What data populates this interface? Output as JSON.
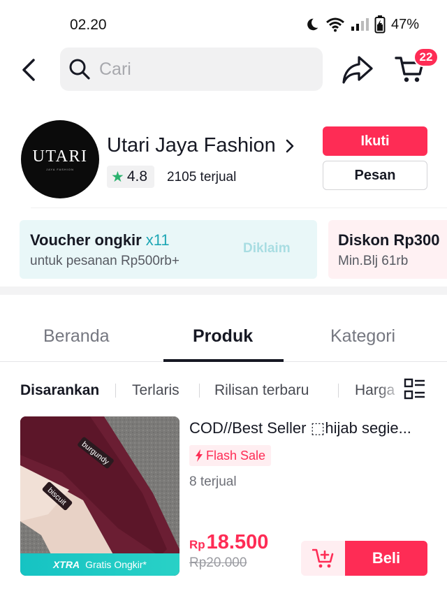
{
  "status_bar": {
    "time": "02.20",
    "battery": "47%",
    "icons": [
      "moon-icon",
      "wifi-icon",
      "signal-icon",
      "battery-charging-icon"
    ]
  },
  "top_nav": {
    "search_placeholder": "Cari",
    "cart_badge": "22",
    "icons": [
      "back-arrow-icon",
      "search-icon",
      "share-icon",
      "cart-icon"
    ]
  },
  "shop": {
    "logo_text": "UTARI",
    "logo_subtext": "JAYA FASHION",
    "name": "Utari Jaya Fashion",
    "rating": "4.8",
    "sold": "2105 terjual",
    "follow_label": "Ikuti",
    "message_label": "Pesan"
  },
  "vouchers": [
    {
      "title": "Voucher ongkir",
      "multiplier": "x11",
      "subtitle": "untuk pesanan Rp500rb+",
      "status": "Diklaim"
    },
    {
      "title": "Diskon Rp300",
      "subtitle": "Min.Blj 61rb"
    }
  ],
  "tabs": [
    {
      "label": "Beranda",
      "active": false
    },
    {
      "label": "Produk",
      "active": true
    },
    {
      "label": "Kategori",
      "active": false
    }
  ],
  "filters": [
    {
      "label": "Disarankan",
      "active": true
    },
    {
      "label": "Terlaris",
      "active": false
    },
    {
      "label": "Rilisan terbaru",
      "active": false
    },
    {
      "label": "Harga",
      "active": false
    }
  ],
  "product": {
    "title": "COD//Best Seller ⬚hijab segie...",
    "flash_label": "Flash Sale",
    "sold": "8 terjual",
    "currency": "Rp",
    "price": "18.500",
    "original_price": "Rp20.000",
    "image_labels": [
      "burgundy",
      "biscuit"
    ],
    "xtra_label": "XTRA",
    "shipping_label": "Gratis Ongkir*",
    "buy_label": "Beli"
  },
  "colors": {
    "accent": "#fe2c55",
    "teal": "#1fa7b5",
    "rating_star": "#2ab26e"
  }
}
